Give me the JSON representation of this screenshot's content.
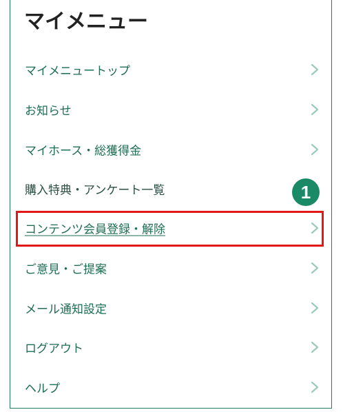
{
  "menu": {
    "title": "マイメニュー",
    "items": [
      {
        "label": "マイメニュートップ"
      },
      {
        "label": "お知らせ"
      },
      {
        "label": "マイホース・総獲得金"
      },
      {
        "label": "購入特典・アンケート一覧"
      },
      {
        "label": "コンテンツ会員登録・解除"
      },
      {
        "label": "ご意見・ご提案"
      },
      {
        "label": "メール通知設定"
      },
      {
        "label": "ログアウト"
      },
      {
        "label": "ヘルプ"
      }
    ]
  },
  "annotation": {
    "step_number": "1",
    "highlight_color": "#e01818",
    "badge_color": "#1a8a66"
  },
  "colors": {
    "accent": "#1d7f5c",
    "link": "#1e6e52",
    "title": "#222222"
  },
  "icons": {
    "item_chevron": "chevron-right-icon"
  }
}
